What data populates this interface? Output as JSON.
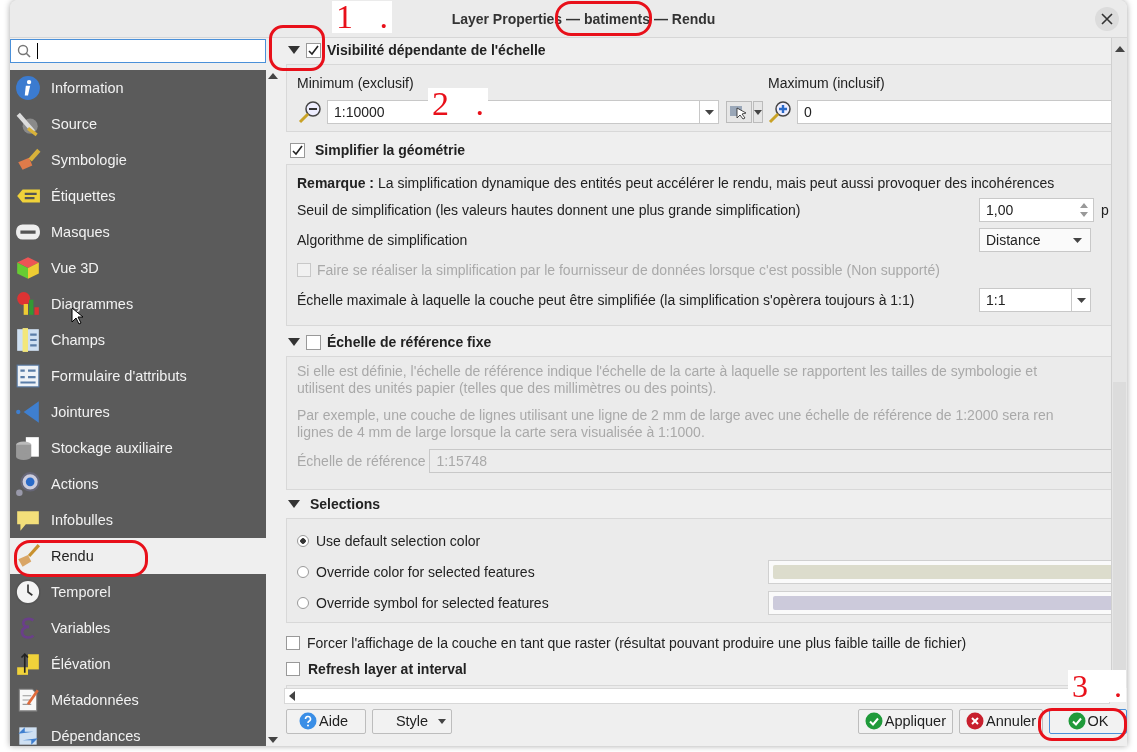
{
  "window": {
    "title": "Layer Properties — batiments — Rendu"
  },
  "sidebar": {
    "items": [
      {
        "label": "Information",
        "selected": false
      },
      {
        "label": "Source",
        "selected": false
      },
      {
        "label": "Symbologie",
        "selected": false
      },
      {
        "label": "Étiquettes",
        "selected": false
      },
      {
        "label": "Masques",
        "selected": false
      },
      {
        "label": "Vue 3D",
        "selected": false
      },
      {
        "label": "Diagrammes",
        "selected": false
      },
      {
        "label": "Champs",
        "selected": false
      },
      {
        "label": "Formulaire d'attributs",
        "selected": false
      },
      {
        "label": "Jointures",
        "selected": false
      },
      {
        "label": "Stockage auxiliaire",
        "selected": false
      },
      {
        "label": "Actions",
        "selected": false
      },
      {
        "label": "Infobulles",
        "selected": false
      },
      {
        "label": "Rendu",
        "selected": true
      },
      {
        "label": "Temporel",
        "selected": false
      },
      {
        "label": "Variables",
        "selected": false
      },
      {
        "label": "Élévation",
        "selected": false
      },
      {
        "label": "Métadonnées",
        "selected": false
      },
      {
        "label": "Dépendances",
        "selected": false
      }
    ]
  },
  "scale_visibility": {
    "expanded": true,
    "checked": true,
    "label": "Visibilité dépendante de l'échelle",
    "minimum_label": "Minimum (exclusif)",
    "minimum": "1:10000",
    "maximum_label": "Maximum (inclusif)",
    "maximum": "0"
  },
  "simplify": {
    "checked": true,
    "label": "Simplifier la géométrie",
    "note": "**Remarque :** La simplification dynamique des entités peut accélérer le rendu, mais peut aussi provoquer des incohérences",
    "threshold_label": "Seuil de simplification (les valeurs hautes donnent une plus grande simplification)",
    "threshold": "1,00",
    "threshold_unit": "p",
    "algorithm_label": "Algorithme de simplification",
    "algorithm": "Distance",
    "provider": {
      "label": "Faire se réaliser la simplification par le fournisseur de données lorsque c'est possible (Non supporté)",
      "checked": false,
      "disabled": true
    },
    "max_scale_label": "Échelle maximale à laquelle la couche peut être simplifiée (la simplification s'opèrera toujours à 1:1)",
    "max_scale": "1:1"
  },
  "reference_scale": {
    "expanded": true,
    "checked": false,
    "disabled": true,
    "label": "Échelle de référence fixe",
    "paragraphs": [
      [
        "Si elle est définie, l'échelle de référence indique l'échelle de la carte à laquelle se rapportent les tailles de symbologie et",
        "utilisent des unités papier (telles que des millimètres ou des points)."
      ],
      [
        "Par exemple, une couche de lignes utilisant une ligne de 2 mm de large avec une échelle de référence de 1:2000 sera ren",
        "lignes de 4 mm de large lorsque la carte sera visualisée à 1:1000."
      ]
    ],
    "scale_label": "Échelle de référence",
    "scale": "1:15748"
  },
  "selections": {
    "expanded": true,
    "label": "Selections",
    "options": [
      {
        "label": "Use default selection color",
        "selected": true
      },
      {
        "label": "Override color for selected features",
        "selected": false,
        "color": "#dcdccc"
      },
      {
        "label": "Override symbol for selected features",
        "selected": false,
        "color": "#cccadb"
      }
    ]
  },
  "force_raster": {
    "label": "Forcer l'affichage de la couche en tant que raster (résultat pouvant produire une plus faible taille de fichier)",
    "checked": false
  },
  "refresh": {
    "label": "Refresh layer at interval",
    "checked": false
  },
  "buttons_left": [
    {
      "label": "Aide",
      "kind": "help"
    },
    {
      "label": "Style",
      "kind": "menu"
    }
  ],
  "buttons_right": [
    {
      "label": "Appliquer",
      "kind": "apply"
    },
    {
      "label": "Annuler",
      "kind": "cancel"
    },
    {
      "label": "OK",
      "kind": "ok"
    }
  ],
  "annotations": [
    {
      "label": "1 ."
    },
    {
      "label": "2 ."
    },
    {
      "label": "3 ."
    }
  ]
}
